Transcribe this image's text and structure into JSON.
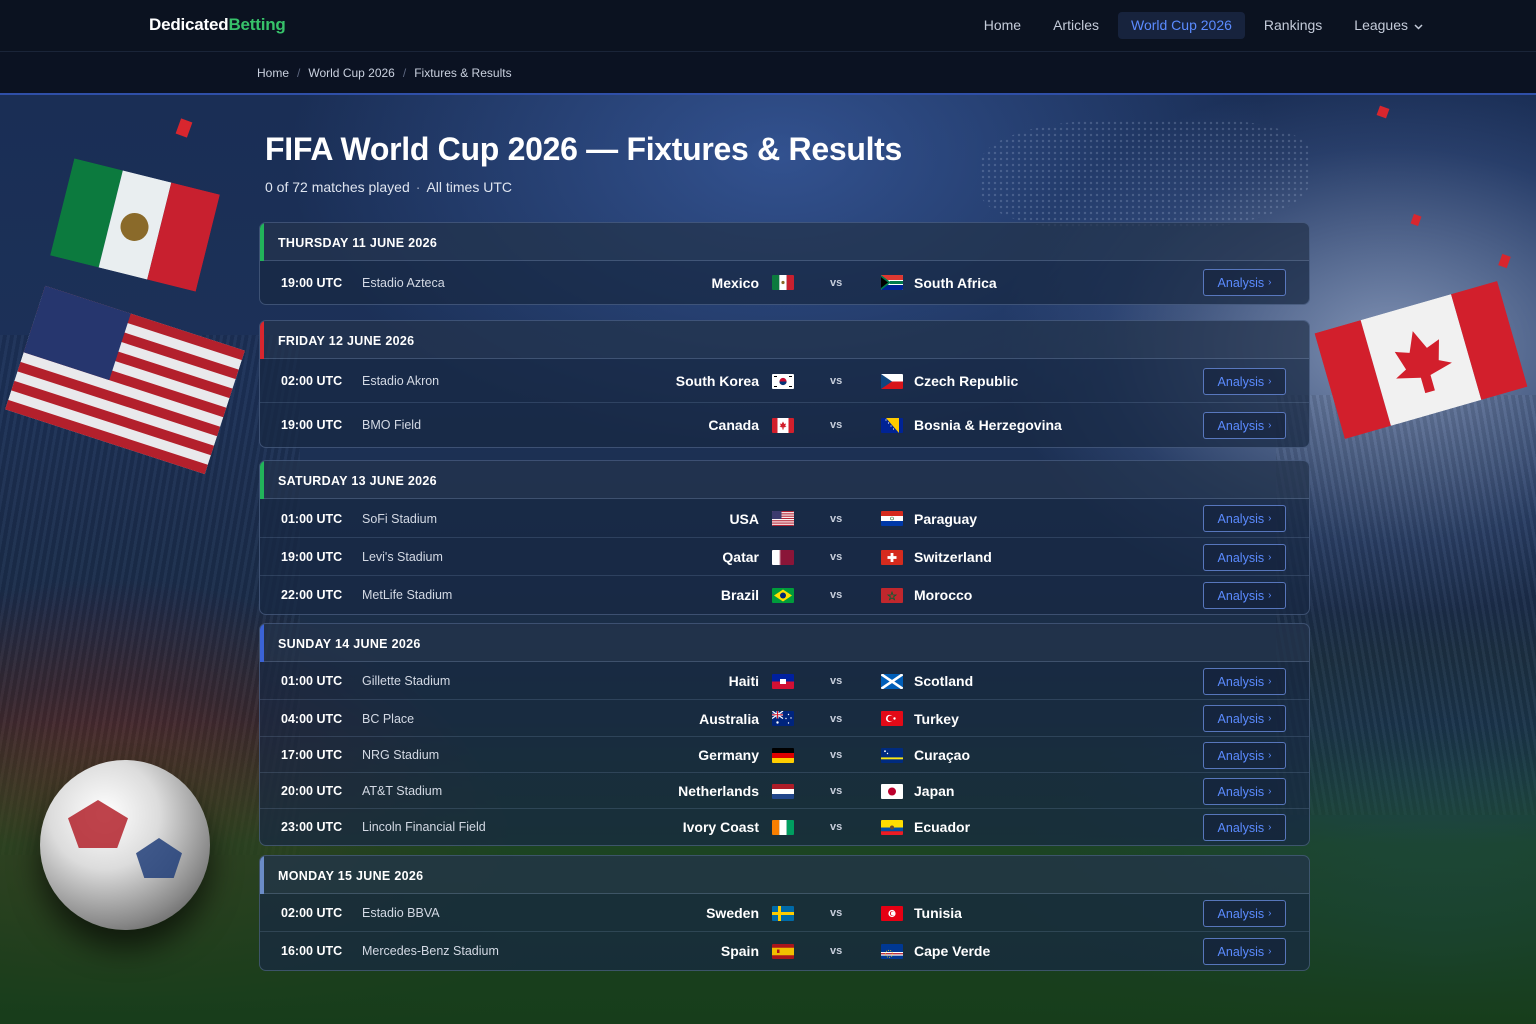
{
  "brand": {
    "part1": "Dedicated",
    "part2": "Betting"
  },
  "nav": {
    "items": [
      {
        "label": "Home"
      },
      {
        "label": "Articles"
      },
      {
        "label": "World Cup 2026",
        "active": true
      },
      {
        "label": "Rankings"
      },
      {
        "label": "Leagues",
        "dropdown": true
      }
    ]
  },
  "breadcrumb": [
    "Home",
    "World Cup 2026",
    "Fixtures & Results"
  ],
  "page": {
    "title": "FIFA World Cup 2026 — Fixtures & Results",
    "matches_played": "0 of 72 matches played",
    "timezone_note": "All times UTC"
  },
  "vs_label": "vs",
  "analysis_label": "Analysis",
  "days": [
    {
      "title": "THURSDAY 11 JUNE 2026",
      "accent": "#22b35a",
      "matches": [
        {
          "time": "19:00 UTC",
          "venue": "Estadio Azteca",
          "home": "Mexico",
          "home_flag": "mx",
          "away": "South Africa",
          "away_flag": "za"
        }
      ]
    },
    {
      "title": "FRIDAY 12 JUNE 2026",
      "accent": "#d8262e",
      "matches": [
        {
          "time": "02:00 UTC",
          "venue": "Estadio Akron",
          "home": "South Korea",
          "home_flag": "kr",
          "away": "Czech Republic",
          "away_flag": "cz"
        },
        {
          "time": "19:00 UTC",
          "venue": "BMO Field",
          "home": "Canada",
          "home_flag": "ca",
          "away": "Bosnia & Herzegovina",
          "away_flag": "ba"
        }
      ]
    },
    {
      "title": "SATURDAY 13 JUNE 2026",
      "accent": "#22b35a",
      "matches": [
        {
          "time": "01:00 UTC",
          "venue": "SoFi Stadium",
          "home": "USA",
          "home_flag": "us",
          "away": "Paraguay",
          "away_flag": "py"
        },
        {
          "time": "19:00 UTC",
          "venue": "Levi's Stadium",
          "home": "Qatar",
          "home_flag": "qa",
          "away": "Switzerland",
          "away_flag": "ch"
        },
        {
          "time": "22:00 UTC",
          "venue": "MetLife Stadium",
          "home": "Brazil",
          "home_flag": "br",
          "away": "Morocco",
          "away_flag": "ma"
        }
      ]
    },
    {
      "title": "SUNDAY 14 JUNE 2026",
      "accent": "#3b63d6",
      "matches": [
        {
          "time": "01:00 UTC",
          "venue": "Gillette Stadium",
          "home": "Haiti",
          "home_flag": "ht",
          "away": "Scotland",
          "away_flag": "sc"
        },
        {
          "time": "04:00 UTC",
          "venue": "BC Place",
          "home": "Australia",
          "home_flag": "au",
          "away": "Turkey",
          "away_flag": "tr"
        },
        {
          "time": "17:00 UTC",
          "venue": "NRG Stadium",
          "home": "Germany",
          "home_flag": "de",
          "away": "Curaçao",
          "away_flag": "cw"
        },
        {
          "time": "20:00 UTC",
          "venue": "AT&T Stadium",
          "home": "Netherlands",
          "home_flag": "nl",
          "away": "Japan",
          "away_flag": "jp"
        },
        {
          "time": "23:00 UTC",
          "venue": "Lincoln Financial Field",
          "home": "Ivory Coast",
          "home_flag": "ci",
          "away": "Ecuador",
          "away_flag": "ec"
        }
      ]
    },
    {
      "title": "MONDAY 15 JUNE 2026",
      "accent": "#6b8cc7",
      "matches": [
        {
          "time": "02:00 UTC",
          "venue": "Estadio BBVA",
          "home": "Sweden",
          "home_flag": "se",
          "away": "Tunisia",
          "away_flag": "tn"
        },
        {
          "time": "16:00 UTC",
          "venue": "Mercedes-Benz Stadium",
          "home": "Spain",
          "home_flag": "es",
          "away": "Cape Verde",
          "away_flag": "cv"
        }
      ]
    }
  ]
}
